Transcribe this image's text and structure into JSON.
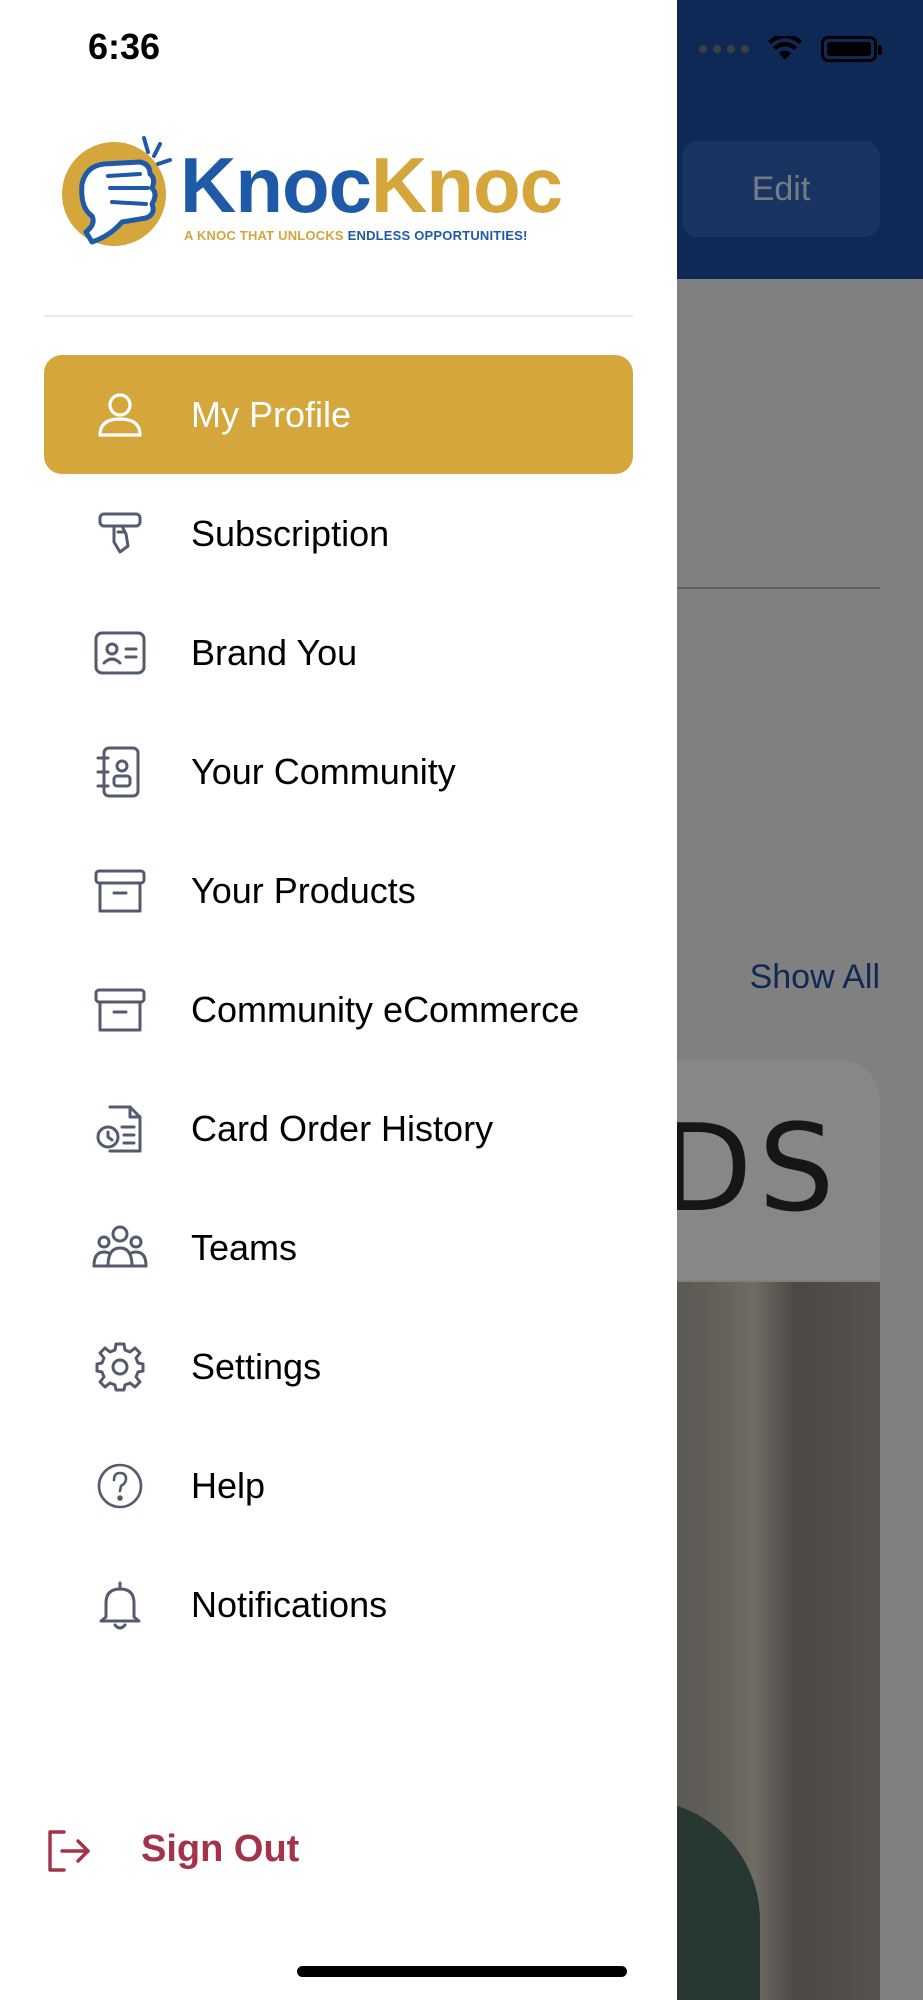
{
  "status_bar": {
    "time": "6:36"
  },
  "background": {
    "edit_label": "Edit",
    "show_all_label": "Show All",
    "card_text": "DS",
    "header_color": "#1b4ea3"
  },
  "brand": {
    "name_part1": "Knoc",
    "name_part2": "Knoc",
    "tagline_part1": "A KNOC THAT UNLOCKS ",
    "tagline_part2": "ENDLESS OPPORTUNITIES!",
    "colors": {
      "blue": "#1f5aa8",
      "gold": "#d4a63b"
    }
  },
  "menu": {
    "items": [
      {
        "label": "My Profile",
        "icon": "user-icon",
        "active": true
      },
      {
        "label": "Subscription",
        "icon": "subscription-icon",
        "active": false
      },
      {
        "label": "Brand You",
        "icon": "id-card-icon",
        "active": false
      },
      {
        "label": "Your Community",
        "icon": "contacts-book-icon",
        "active": false
      },
      {
        "label": "Your Products",
        "icon": "archive-box-icon",
        "active": false
      },
      {
        "label": "Community eCommerce",
        "icon": "archive-box-icon",
        "active": false
      },
      {
        "label": "Card Order History",
        "icon": "order-history-icon",
        "active": false
      },
      {
        "label": "Teams",
        "icon": "team-icon",
        "active": false
      },
      {
        "label": "Settings",
        "icon": "gear-icon",
        "active": false
      },
      {
        "label": "Help",
        "icon": "help-icon",
        "active": false
      },
      {
        "label": "Notifications",
        "icon": "bell-icon",
        "active": false
      }
    ],
    "active_color": "#d4a63b"
  },
  "sign_out": {
    "label": "Sign Out",
    "color": "#a3334a"
  }
}
